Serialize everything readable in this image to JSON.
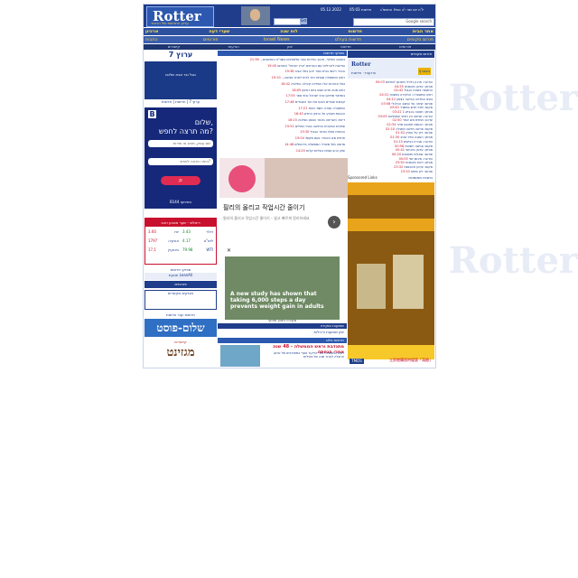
{
  "header": {
    "logo_text": "Rotter",
    "logo_sub": "ערוץ החדשות של הרוטר",
    "date": "05.12.2022",
    "time": "05:03",
    "label": "חדשות",
    "tagline": "ל'ה יום שני י'ב כסלו התשפ'ג",
    "google_label": "Google search",
    "search_button": "Go"
  },
  "nav": {
    "row1": [
      "אתר הבית",
      "חדשות",
      "לוח שנה",
      "שערי דעה",
      "ארכיון"
    ],
    "row2": [
      "פורום סקופים",
      "חדשות בעולם",
      "Israel News",
      "פורומים",
      "כתבות"
    ],
    "row3": [
      "פורומים",
      "חדשות",
      "יומן",
      "הודעות",
      "קישורים"
    ]
  },
  "left": {
    "arutz_title": "ערוץ 7",
    "arutz_text": "גוגל נגד אבא שלכם",
    "arutz_links": "ערוץ 7 | חדשות | חדשות",
    "bphone_b": "B",
    "bphone_t1": "שלום,",
    "bphone_t2": "מה תרצה לחפש?",
    "bphone_field1": "שם עסק, מותג או שירות",
    "bphone_field2": "איפה תרצה לחפש?",
    "bphone_btn": "⌕",
    "bphone_foot": "B144 בשיתוף",
    "markets_hd": "ריאלטי - שער מטבע וזהב",
    "markets_rows": [
      {
        "name": "דולר",
        "val": "3.43"
      },
      {
        "name": "יורו",
        "val": "3.60"
      },
      {
        "name": "ליש\"ט",
        "val": "4.17"
      },
      {
        "name": "אונקיה",
        "val": "1797"
      },
      {
        "name": "WTI",
        "val": "79.98"
      },
      {
        "name": "ביטקוין",
        "val": "17,1"
      }
    ],
    "block1": "מבזקי חדשות",
    "block2": "תנועת LeanAll",
    "block3": "פורומים",
    "block4": "מבזקים מקשרים",
    "block5": "חדשות ועוד חדשות",
    "banner1": "שלום-פוסט",
    "banner2": "קישורים",
    "banner3": "מגזינט"
  },
  "middle": {
    "news_hd": "מבזקי חדשות",
    "news": [
      {
        "tm": "21:36",
        "text": "בשבוע החולף, ארגון החירות עצר פלסטינים בשב\"ח הנחשבים..."
      },
      {
        "tm": "19:45",
        "text": "הודעות ליברליות עם הפרחים 'ארץ ישראל' הפורום"
      },
      {
        "tm": "19:38",
        "text": "הנכיר ראשי בבית ספר ידוע בתל אביב"
      },
      {
        "tm": "19:10",
        "text": "ראש הממשלה שפתח חזר לבית לאחר פגישה..."
      },
      {
        "tm": "18:42",
        "text": "בצל אזהרות אלו המדינה קיבלה החלטה"
      },
      {
        "tm": "18:05",
        "text": "ראש מטה חדש יפגש ביום ראשון"
      },
      {
        "tm": "17:55",
        "text": "בשיתוף מוזיאון ארץ ישראל ובתי ספר"
      },
      {
        "tm": "17:48",
        "text": "קבוצת עובדים תבעו את ועד העובדים"
      },
      {
        "tm": "17:21",
        "text": "המשטרה עצרה חשוד בשוד"
      },
      {
        "tm": "16:40",
        "text": "הכנסת תצביע על החוק החדש"
      },
      {
        "tm": "16:15",
        "text": "דיווח: השריפה באזור הצפון נשלטה"
      },
      {
        "tm": "15:52",
        "text": "פתיחת התוכנית החדשה בבתי החולים"
      },
      {
        "tm": "15:30",
        "text": "הכוחות פעלו באזור הגבול"
      },
      {
        "tm": "15:04",
        "text": "תחזית מזג האוויר: גשם מקומי"
      },
      {
        "tm": "14:48",
        "text": "מחאה מול משרדי הממשלה בירושלים"
      },
      {
        "tm": "14:20",
        "text": "שוק ההון נפתח בעליות קלות"
      }
    ],
    "ad1_title": "필리의 올리고 작업시간 줄이기",
    "ad1_desc": "필리의 올리고 작업시간 줄이기 – 쉽고 빠르게 정리하세요",
    "ad1_arrow": "›",
    "ad2_x": "✕",
    "ad2_caption": "A new study has shown that taking 6,000 steps a day prevents weight gain in adults",
    "ad2_foot": "סקירה ותוכן שיווקי",
    "rumors": "שמועות וסקירה",
    "rumors2": "יומן שמועות ורכילות",
    "lnews_hd": "חדשות בלוג",
    "lnews_title": "מתנדבת וראש הממשלה - 48 שנה אחרי הנחתה",
    "lnews_body": "ראש הממשלה חזר לביקור נוסף במתנדבים של ארגון ההצלה לאחר שנה של פעילות"
  },
  "right": {
    "hd": "פורום סקופים",
    "logo": "Rotter",
    "btn": "הצטרף",
    "links": "הודעות · חדשות",
    "rows": [
      {
        "tm": "05:03",
        "text": "הודעה: ארגון כלכלי מתכונן לשיחות"
      },
      {
        "tm": "04:55",
        "text": "מבזק: עדכון מהשטח"
      },
      {
        "tm": "04:42",
        "text": "התקפה בשטח הגבול"
      },
      {
        "tm": "04:31",
        "text": "ראש המשטרה: החקירה נמשכת"
      },
      {
        "tm": "04:12",
        "text": "נשיא המדינה בביקור בצפון"
      },
      {
        "tm": "03:58",
        "text": "פורום: שיחה על המצב הכלכלי"
      },
      {
        "tm": "03:40",
        "text": "סקופ: מינוי חדש במשרד"
      },
      {
        "tm": "03:22",
        "text": "מבזק: תאונה בכביש 1"
      },
      {
        "tm": "03:05",
        "text": "הודעה: פגישה בין ראשי המפלגות"
      },
      {
        "tm": "02:50",
        "text": "עדכון: תחזית מזג אוויר"
      },
      {
        "tm": "02:34",
        "text": "מבזק: הכנסת תתכנס מחר"
      },
      {
        "tm": "02:10",
        "text": "סקופ: פרשה חדשה מתגלה"
      },
      {
        "tm": "01:52",
        "text": "פורום: דיון על החוק"
      },
      {
        "tm": "01:30",
        "text": "מבזק: הפגנה בתל אביב"
      },
      {
        "tm": "01:15",
        "text": "הודעה: סגירת כבישים"
      },
      {
        "tm": "00:58",
        "text": "סקופ: פגישה חשאית"
      },
      {
        "tm": "00:41",
        "text": "מבזק: עדכון ביטחוני"
      },
      {
        "tm": "00:20",
        "text": "פורום: שאלות ותשובות"
      },
      {
        "tm": "00:05",
        "text": "הודעה: סיכום יומי"
      },
      {
        "tm": "23:50",
        "text": "מבזק: דיווח מהשטח"
      },
      {
        "tm": "23:32",
        "text": "סקופ: עדכון מהכנסת"
      },
      {
        "tm": "23:10",
        "text": "פורום: דיון פתוח"
      }
    ],
    "sponsored": "Sponsored Links",
    "sponsored_he": "כתבות ממומנות",
    "ad_caption": "立即搶購限時優惠「滿額」",
    "ad_tag": "TMDS"
  },
  "watermark": "Rotter"
}
